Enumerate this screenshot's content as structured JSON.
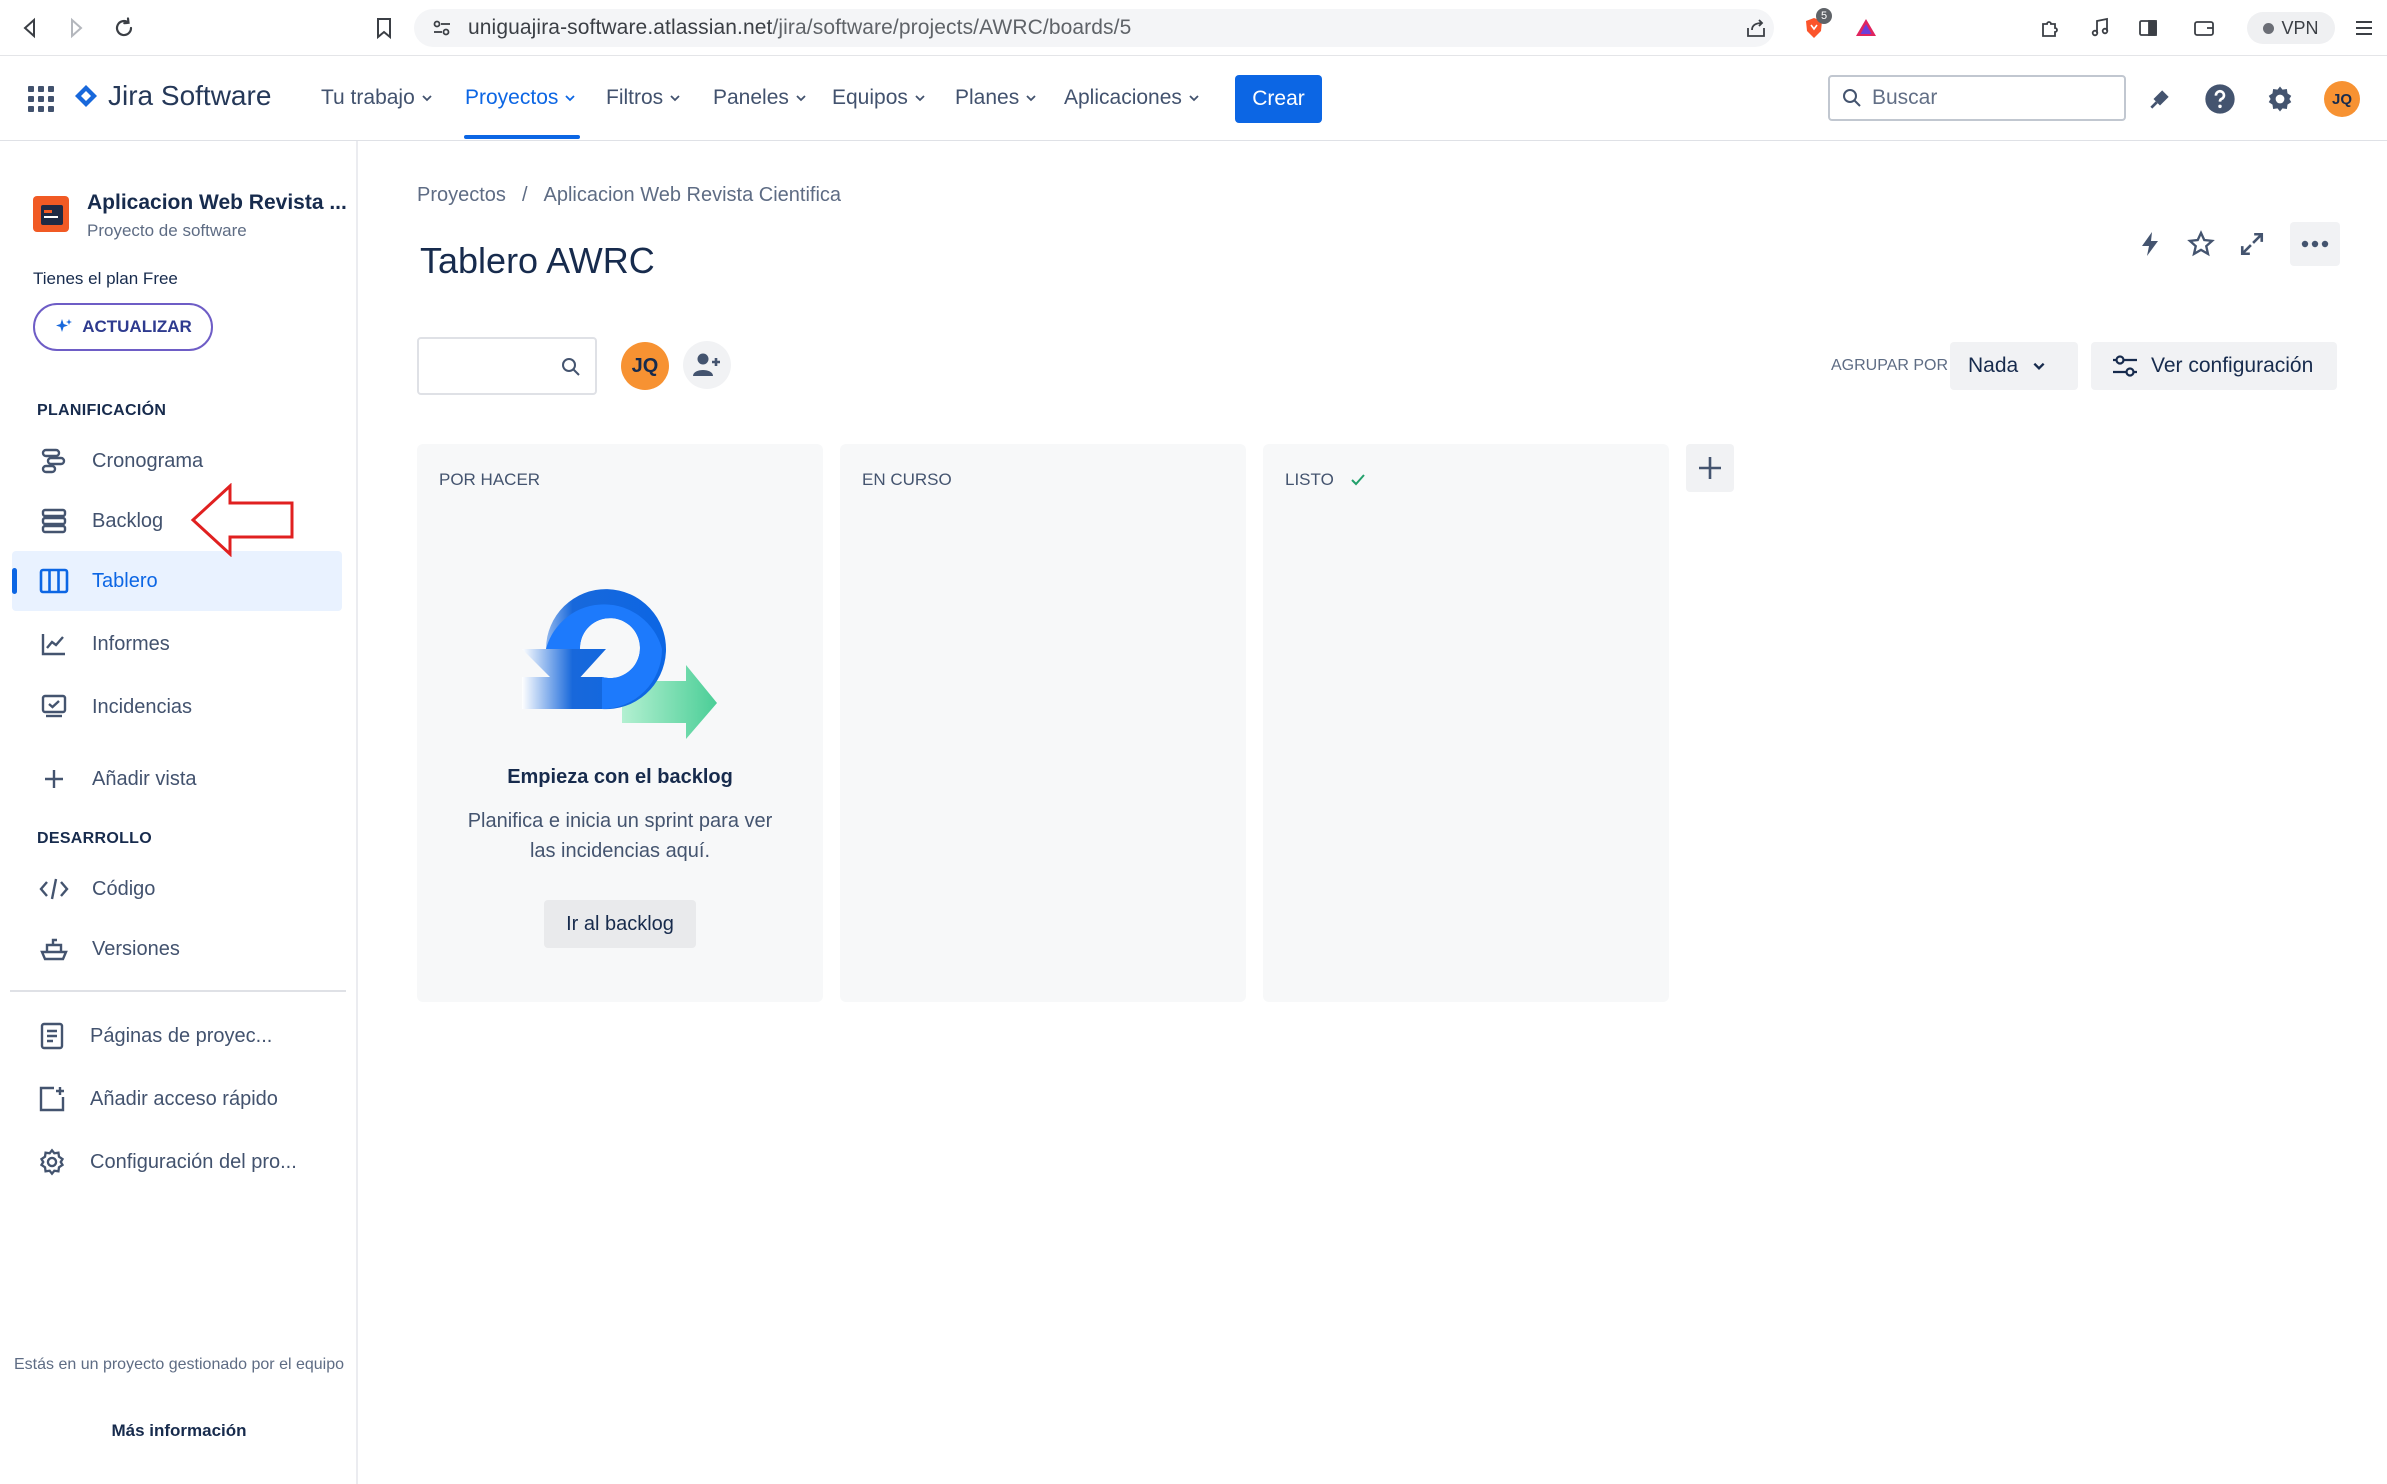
{
  "browser": {
    "url_host": "uniguajira-software.atlassian.net",
    "url_path": "/jira/software/projects/AWRC/boards/5",
    "shield_badge": "5",
    "vpn_label": "VPN"
  },
  "topnav": {
    "logo_text": "Jira Software",
    "items": [
      {
        "label": "Tu trabajo"
      },
      {
        "label": "Proyectos"
      },
      {
        "label": "Filtros"
      },
      {
        "label": "Paneles"
      },
      {
        "label": "Equipos"
      },
      {
        "label": "Planes"
      },
      {
        "label": "Aplicaciones"
      }
    ],
    "create_label": "Crear",
    "search_placeholder": "Buscar",
    "avatar_initials": "JQ"
  },
  "sidebar": {
    "project_name": "Aplicacion Web Revista ...",
    "project_type": "Proyecto de software",
    "plan_text": "Tienes el plan Free",
    "upgrade_label": "ACTUALIZAR",
    "planning_heading": "PLANIFICACIÓN",
    "planning_items": [
      {
        "label": "Cronograma"
      },
      {
        "label": "Backlog"
      },
      {
        "label": "Tablero"
      },
      {
        "label": "Informes"
      },
      {
        "label": "Incidencias"
      },
      {
        "label": "Añadir vista"
      }
    ],
    "dev_heading": "DESARROLLO",
    "dev_items": [
      {
        "label": "Código"
      },
      {
        "label": "Versiones"
      }
    ],
    "extra_items": [
      {
        "label": "Páginas de proyec..."
      },
      {
        "label": "Añadir acceso rápido"
      },
      {
        "label": "Configuración del pro..."
      }
    ],
    "footer_text": "Estás en un proyecto gestionado por el equipo",
    "footer_link": "Más información"
  },
  "main": {
    "breadcrumb": [
      "Proyectos",
      "/",
      "Aplicacion Web Revista Cientifica"
    ],
    "title": "Tablero AWRC",
    "member_initials": "JQ",
    "group_by_label": "AGRUPAR POR",
    "group_by_value": "Nada",
    "config_label": "Ver configuración",
    "columns": [
      {
        "title": "POR HACER"
      },
      {
        "title": "EN CURSO"
      },
      {
        "title": "LISTO"
      }
    ],
    "empty_state": {
      "title": "Empieza con el backlog",
      "description": "Planifica e inicia un sprint para ver las incidencias aquí.",
      "button": "Ir al backlog"
    }
  },
  "colors": {
    "accent": "#0c66e4",
    "avatar": "#f79232",
    "annotation_arrow": "#e02020"
  }
}
